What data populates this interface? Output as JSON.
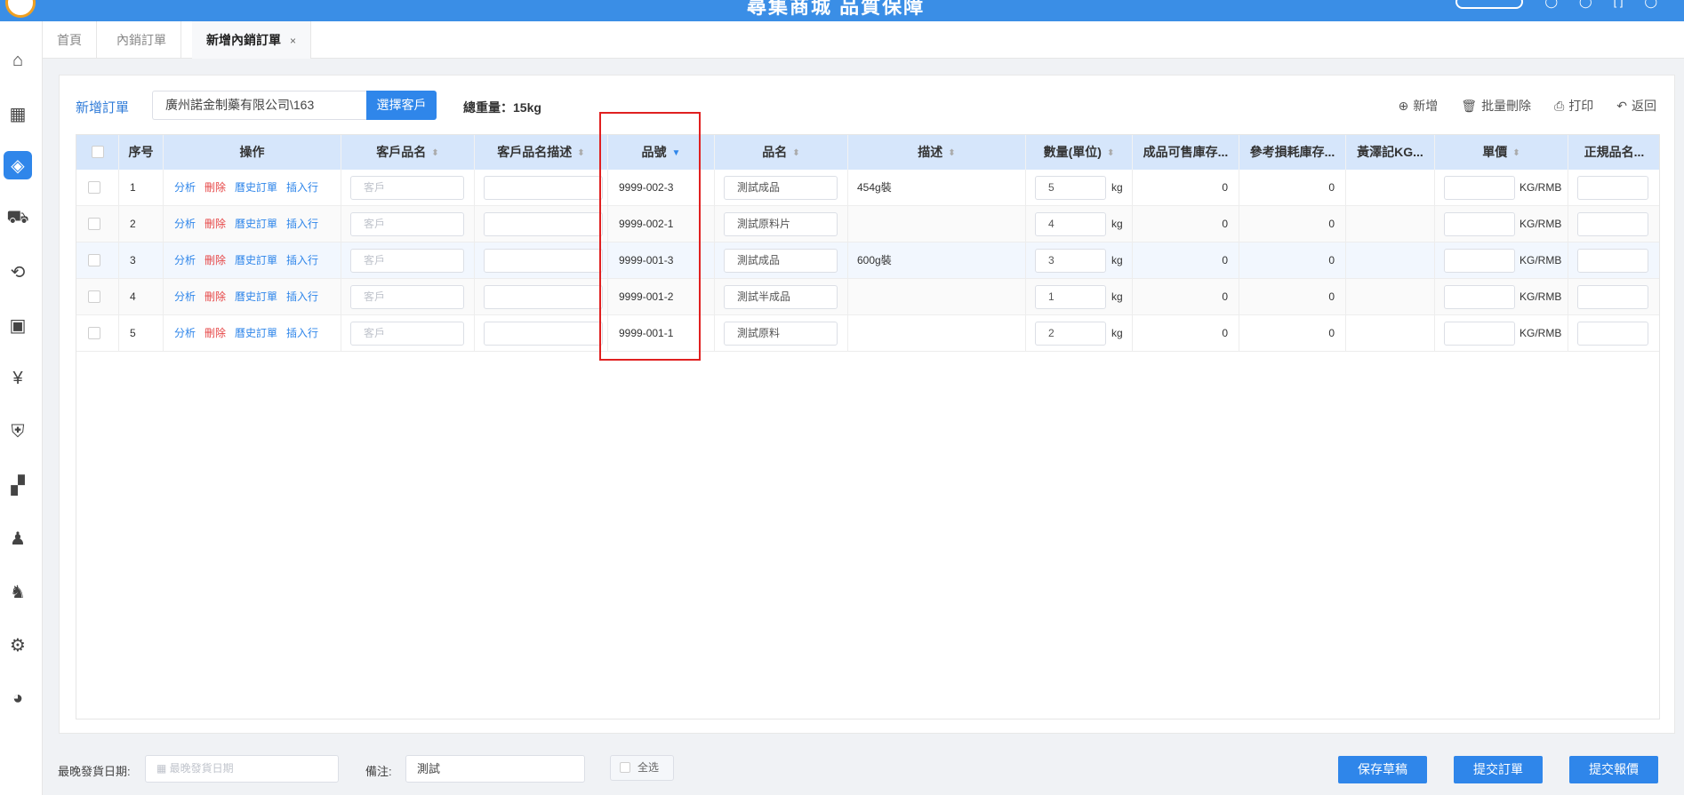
{
  "header": {
    "title": "尋集商城 品質保障"
  },
  "tabs": [
    {
      "label": "首頁"
    },
    {
      "label": "內銷訂單"
    },
    {
      "label": "新增內銷訂單",
      "close": "×"
    }
  ],
  "order": {
    "label": "新增訂單",
    "customer_value": "廣州諾金制藥有限公司\\163",
    "select_customer_label": "選擇客戶",
    "total_weight": "總重量：15kg"
  },
  "toolbar": {
    "add_label": "新增",
    "batch_delete_label": "批量刪除",
    "print_label": "打印",
    "back_label": "返回"
  },
  "columns": [
    {
      "label": ""
    },
    {
      "label": "序号"
    },
    {
      "label": "操作"
    },
    {
      "label": "客戶品名"
    },
    {
      "label": "客戶品名描述"
    },
    {
      "label": "品號"
    },
    {
      "label": "品名"
    },
    {
      "label": "描述"
    },
    {
      "label": "數量(單位)"
    },
    {
      "label": "成品可售庫存..."
    },
    {
      "label": "參考損耗庫存..."
    },
    {
      "label": "黃澤記KG..."
    },
    {
      "label": "單價"
    },
    {
      "label": "正規品名..."
    }
  ],
  "row_actions": {
    "analyze": "分析",
    "delete": "刪除",
    "history": "曆史訂單",
    "insert": "插入行"
  },
  "customer_placeholder": "客戶",
  "price_unit": "KG/RMB",
  "rows": [
    {
      "index": "1",
      "item_no": "9999-002-3",
      "item_name": "測試成品",
      "desc": "454g裝",
      "qty": "5",
      "unit": "kg",
      "stock": "0",
      "loss_stock": "0"
    },
    {
      "index": "2",
      "item_no": "9999-002-1",
      "item_name": "測試原料片",
      "desc": "",
      "qty": "4",
      "unit": "kg",
      "stock": "0",
      "loss_stock": "0"
    },
    {
      "index": "3",
      "item_no": "9999-001-3",
      "item_name": "測試成品",
      "desc": "600g裝",
      "qty": "3",
      "unit": "kg",
      "stock": "0",
      "loss_stock": "0"
    },
    {
      "index": "4",
      "item_no": "9999-001-2",
      "item_name": "測試半成品",
      "desc": "",
      "qty": "1",
      "unit": "kg",
      "stock": "0",
      "loss_stock": "0"
    },
    {
      "index": "5",
      "item_no": "9999-001-1",
      "item_name": "測試原料",
      "desc": "",
      "qty": "2",
      "unit": "kg",
      "stock": "0",
      "loss_stock": "0"
    }
  ],
  "footer": {
    "latest_date_label": "最晚發貨日期:",
    "latest_date_placeholder": "最晚發貨日期",
    "remark_label": "備注:",
    "remark_value": "測試",
    "select_all_label": "全选",
    "save_draft_label": "保存草稿",
    "submit_order_label": "提交訂單",
    "submit_quote_label": "提交報價"
  }
}
